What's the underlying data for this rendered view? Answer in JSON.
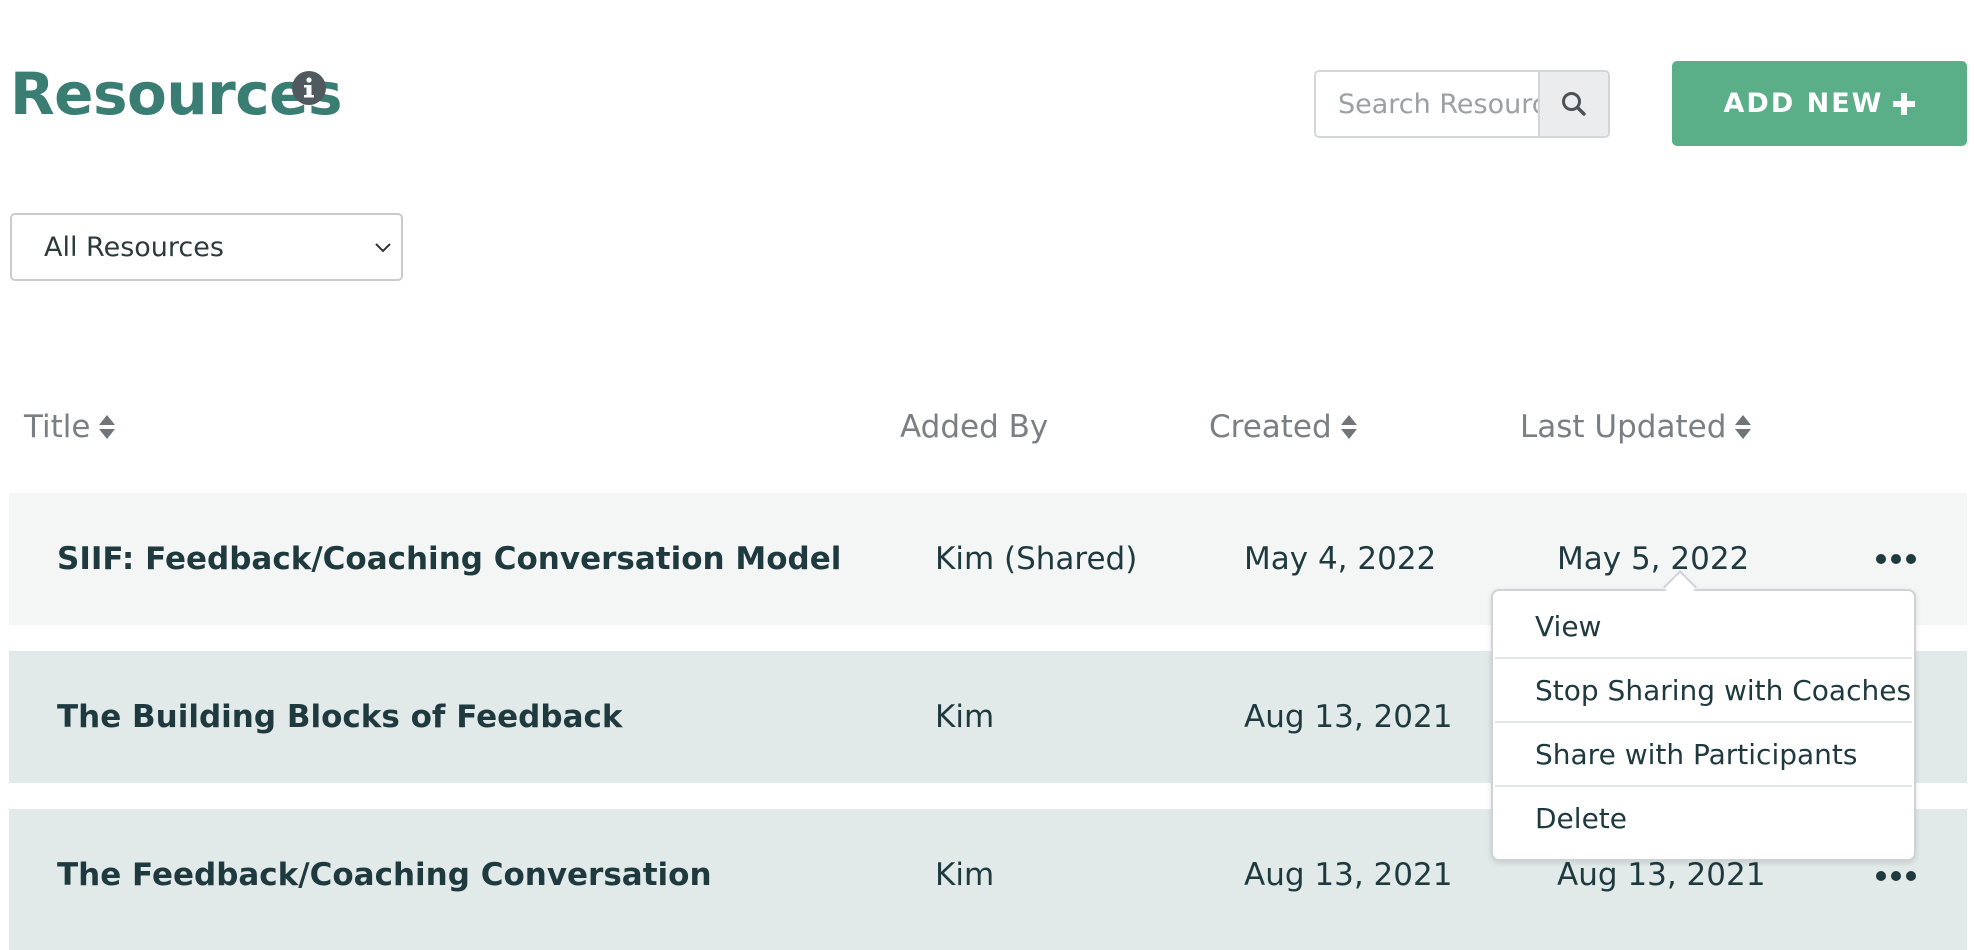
{
  "header": {
    "title": "Resources",
    "search_placeholder": "Search Resources",
    "add_new_label": "ADD NEW"
  },
  "filter": {
    "selected": "All Resources"
  },
  "table": {
    "columns": [
      "Title",
      "Added By",
      "Created",
      "Last Updated"
    ],
    "rows": [
      {
        "title": "SIIF: Feedback/Coaching Conversation Model",
        "added_by": "Kim (Shared)",
        "created": "May 4, 2022",
        "updated": "May 5, 2022"
      },
      {
        "title": "The Building Blocks of Feedback",
        "added_by": "Kim",
        "created": "Aug 13, 2021",
        "updated": ""
      },
      {
        "title": "The Feedback/Coaching Conversation",
        "added_by": "Kim",
        "created": "Aug 13, 2021",
        "updated": "Aug 13, 2021"
      }
    ]
  },
  "menu": {
    "items": [
      "View",
      "Stop Sharing with Coaches",
      "Share with Participants",
      "Delete"
    ]
  },
  "colors": {
    "title": "#3a7d73",
    "accent_button": "#5aae88",
    "row_light": "#f4f6f5",
    "row_tint": "#e1eae9"
  },
  "icons": {
    "info": "info-icon",
    "search": "search-icon",
    "plus": "plus-icon",
    "sort": "sort-icon",
    "chevron": "chevron-down-icon",
    "more": "more-icon"
  }
}
